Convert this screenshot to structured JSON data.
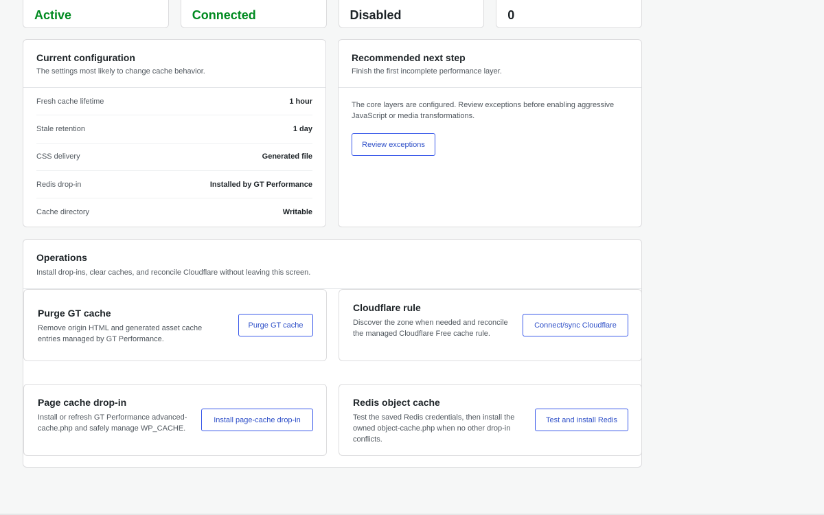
{
  "status": [
    {
      "value": "Active",
      "tone": "ok"
    },
    {
      "value": "Connected",
      "tone": "ok"
    },
    {
      "value": "Disabled",
      "tone": "plain"
    },
    {
      "value": "0",
      "tone": "plain"
    }
  ],
  "config": {
    "title": "Current configuration",
    "subtitle": "The settings most likely to change cache behavior.",
    "rows": [
      {
        "label": "Fresh cache lifetime",
        "value": "1 hour"
      },
      {
        "label": "Stale retention",
        "value": "1 day"
      },
      {
        "label": "CSS delivery",
        "value": "Generated file"
      },
      {
        "label": "Redis drop-in",
        "value": "Installed by GT Performance"
      },
      {
        "label": "Cache directory",
        "value": "Writable"
      }
    ]
  },
  "next_step": {
    "title": "Recommended next step",
    "subtitle": "Finish the first incomplete performance layer.",
    "text": "The core layers are configured. Review exceptions before enabling aggressive JavaScript or media transformations.",
    "button": "Review exceptions"
  },
  "operations": {
    "title": "Operations",
    "subtitle": "Install drop-ins, clear caches, and reconcile Cloudflare without leaving this screen.",
    "tiles": [
      {
        "title": "Purge GT cache",
        "desc": "Remove origin HTML and generated asset cache entries managed by GT Performance.",
        "button": "Purge GT cache"
      },
      {
        "title": "Cloudflare rule",
        "desc": "Discover the zone when needed and reconcile the managed Cloudflare Free cache rule.",
        "button": "Connect/sync Cloudflare"
      },
      {
        "title": "Page cache drop-in",
        "desc": "Install or refresh GT Performance advanced-cache.php and safely manage WP_CACHE.",
        "button": "Install page-cache drop-in"
      },
      {
        "title": "Redis object cache",
        "desc": "Test the saved Redis credentials, then install the owned object-cache.php when no other drop-in conflicts.",
        "button": "Test and install Redis"
      }
    ]
  },
  "colors": {
    "success": "#008a20",
    "accent": "#3858e9",
    "background": "#f6f7f7"
  }
}
